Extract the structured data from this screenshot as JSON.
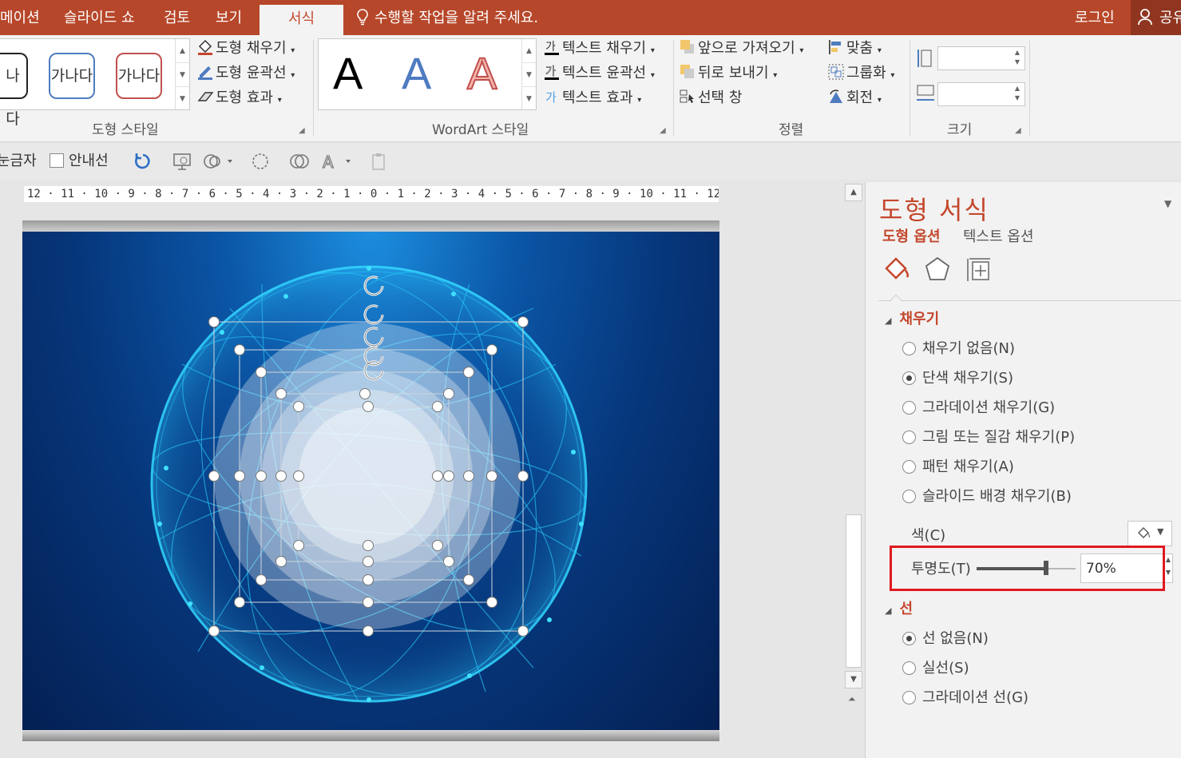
{
  "tabs": [
    {
      "label": "메이션",
      "active": false
    },
    {
      "label": "슬라이드 쇼",
      "active": false
    },
    {
      "label": "검토",
      "active": false
    },
    {
      "label": "보기",
      "active": false
    },
    {
      "label": "서식",
      "active": true
    }
  ],
  "search": {
    "placeholder": "수행할 작업을 알려 주세요."
  },
  "account": {
    "login_label": "로그인",
    "share_label": "공유"
  },
  "ribbon": {
    "shape_styles": {
      "samples": [
        "나다",
        "가나다",
        "가나다"
      ],
      "fill": "도형 채우기",
      "outline": "도형 윤곽선",
      "effect": "도형 효과",
      "label": "도형 스타일"
    },
    "wordart": {
      "samples": [
        "A",
        "A",
        "A"
      ],
      "text_fill": "텍스트 채우기",
      "text_outline": "텍스트 윤곽선",
      "text_effect": "텍스트 효과",
      "label": "WordArt 스타일"
    },
    "arrange": {
      "bring_forward": "앞으로 가져오기",
      "send_backward": "뒤로 보내기",
      "selection_pane": "선택 창",
      "align": "맞춤",
      "group": "그룹화",
      "rotate": "회전",
      "label": "정렬"
    },
    "size": {
      "label": "크기"
    }
  },
  "toolbar": {
    "ruler_label": "눈금자",
    "guides_label": "안내선"
  },
  "ruler": {
    "text": "12 · 11 · 10 · 9 · 8 · 7 · 6 · 5 · 4 · 3 · 2 · 1 · 0 · 1 · 2 · 3 · 4 · 5 · 6 · 7 · 8 · 9 · 10 · 11 · 12"
  },
  "pane": {
    "title": "도형 서식",
    "tab_shape": "도형 옵션",
    "tab_text": "텍스트 옵션",
    "fill_section": "채우기",
    "fill_options": [
      {
        "label": "채우기 없음(N)",
        "selected": false
      },
      {
        "label": "단색 채우기(S)",
        "selected": true
      },
      {
        "label": "그라데이션 채우기(G)",
        "selected": false
      },
      {
        "label": "그림 또는 질감 채우기(P)",
        "selected": false
      },
      {
        "label": "패턴 채우기(A)",
        "selected": false
      },
      {
        "label": "슬라이드 배경 채우기(B)",
        "selected": false
      }
    ],
    "color_label": "색(C)",
    "transparency_label": "투명도(T)",
    "transparency_value": "70%",
    "transparency_level": 0.7,
    "line_section": "선",
    "line_options": [
      {
        "label": "선 없음(N)",
        "selected": true
      },
      {
        "label": "실선(S)",
        "selected": false
      },
      {
        "label": "그라데이션 선(G)",
        "selected": false
      }
    ]
  },
  "colors": {
    "accent": "#b7472a",
    "highlight": "#e0191f",
    "pane_accent": "#c4472c"
  }
}
